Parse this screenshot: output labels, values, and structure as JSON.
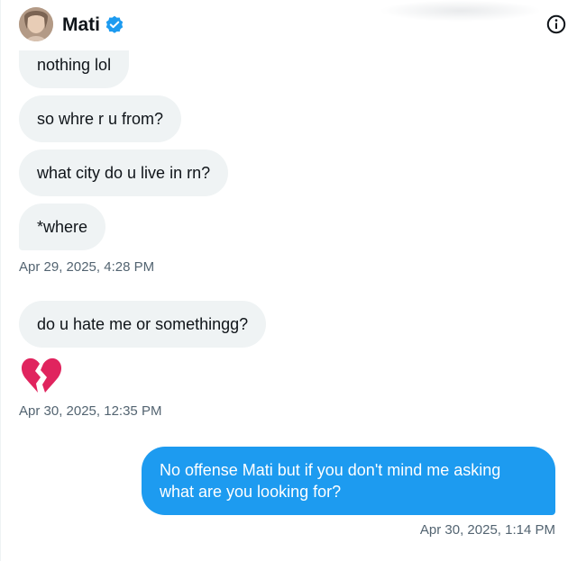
{
  "header": {
    "name": "Mati",
    "verified_icon": "verified-badge-icon",
    "info_icon": "info-icon",
    "avatar": "avatar"
  },
  "messages": [
    {
      "text": "nothing lol",
      "direction": "incoming"
    },
    {
      "text": "so whre r u from?",
      "direction": "incoming"
    },
    {
      "text": "what city do u live in rn?",
      "direction": "incoming"
    },
    {
      "text": "*where",
      "direction": "incoming"
    },
    {
      "text": "do u hate me or somethingg?",
      "direction": "incoming"
    },
    {
      "emoji": "broken-heart-icon",
      "direction": "incoming"
    },
    {
      "text": "No offense Mati but if you don't mind me asking what are you looking for?",
      "direction": "outgoing"
    }
  ],
  "timestamps": [
    "Apr 29, 2025, 4:28 PM",
    "Apr 30, 2025, 12:35 PM",
    "Apr 30, 2025, 1:14 PM"
  ],
  "colors": {
    "incoming_bubble": "#eff3f4",
    "outgoing_bubble": "#1d9bf0",
    "text": "#0f1419",
    "timestamp": "#536471",
    "verified": "#1d9bf0",
    "broken_heart": "#e0245e"
  }
}
